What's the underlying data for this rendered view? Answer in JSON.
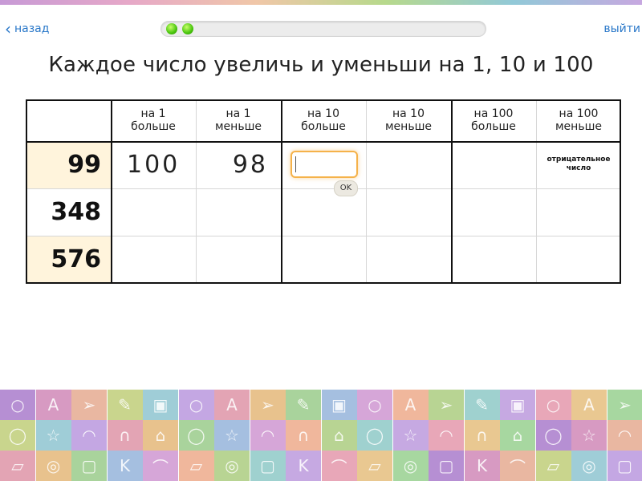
{
  "nav": {
    "back_label": "назад",
    "exit_label": "выйти"
  },
  "progress": {
    "completed": 2
  },
  "task": {
    "title": "Каждое число увеличь и уменьши на 1, 10 и 100"
  },
  "table": {
    "headers": [
      {
        "line1": "на 1",
        "line2": "больше"
      },
      {
        "line1": "на 1",
        "line2": "меньше"
      },
      {
        "line1": "на 10",
        "line2": "больше"
      },
      {
        "line1": "на 10",
        "line2": "меньше"
      },
      {
        "line1": "на 100",
        "line2": "больше"
      },
      {
        "line1": "на 100",
        "line2": "меньше"
      }
    ],
    "rows": [
      {
        "number": "99",
        "answers": [
          "100",
          "98",
          "",
          "",
          "",
          ""
        ]
      },
      {
        "number": "348",
        "answers": [
          "",
          "",
          "",
          "",
          "",
          ""
        ]
      },
      {
        "number": "576",
        "answers": [
          "",
          "",
          "",
          "",
          "",
          ""
        ]
      }
    ],
    "note_text": "отрицательное число",
    "ok_label": "OK",
    "input_value": ""
  },
  "colors": {
    "highlight": "#fff4dc",
    "accent_link": "#2a78c9",
    "input_border": "#f5b24a",
    "progress_dot": "#47c40c"
  },
  "background": {
    "top_tiles": [
      "#b68fd3",
      "#d79ac2",
      "#e9b7a1",
      "#c9d58d",
      "#9fcdd7",
      "#c4a7e3",
      "#e3a4b4",
      "#e8c28d",
      "#a9d39c",
      "#a5bfe0",
      "#d6a6d8",
      "#f0b79c",
      "#b8d493",
      "#9fd1cf",
      "#c6a9e2",
      "#e8a7b8",
      "#e9c891",
      "#a7d7a0"
    ],
    "bottom_icons": [
      "circle-icon",
      "letter-a-icon",
      "paper-plane-icon",
      "pencil-icon",
      "bag-icon",
      "circle-icon",
      "letter-a-icon",
      "paper-plane-icon",
      "pencil-icon",
      "bag-icon",
      "circle-icon",
      "letter-a-icon",
      "paper-plane-icon",
      "pencil-icon",
      "bag-icon",
      "circle-icon",
      "letter-a-icon",
      "paper-plane-icon",
      "apple-icon",
      "star-icon",
      "wifi-icon",
      "headphones-icon",
      "sneaker-icon",
      "apple-icon",
      "star-icon",
      "wifi-icon",
      "headphones-icon",
      "sneaker-icon",
      "apple-icon",
      "star-icon",
      "wifi-icon",
      "headphones-icon",
      "sneaker-icon",
      "apple-icon",
      "star-icon",
      "wifi-icon",
      "eraser-icon",
      "globe-icon",
      "ipod-icon",
      "letter-k-icon",
      "skateboard-icon",
      "eraser-icon",
      "globe-icon",
      "ipod-icon",
      "letter-k-icon",
      "skateboard-icon",
      "eraser-icon",
      "globe-icon",
      "ipod-icon",
      "letter-k-icon",
      "skateboard-icon",
      "eraser-icon",
      "globe-icon",
      "ipod-icon"
    ]
  }
}
